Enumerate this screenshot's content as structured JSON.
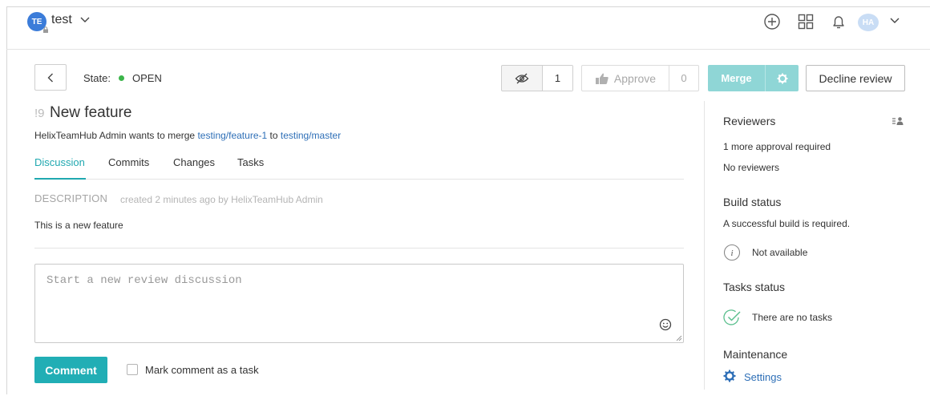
{
  "header": {
    "project_initials": "TE",
    "project_name": "test",
    "user_initials": "HA"
  },
  "review": {
    "state_label": "State:",
    "state_value": "OPEN",
    "watch_count": "1",
    "approve_label": "Approve",
    "approve_count": "0",
    "merge_label": "Merge",
    "decline_label": "Decline review",
    "number": "!9",
    "title": "New feature",
    "merge_prefix": "HelixTeamHub Admin wants to merge",
    "source_branch": "testing/feature-1",
    "merge_to": "to",
    "target_branch": "testing/master"
  },
  "tabs": [
    "Discussion",
    "Commits",
    "Changes",
    "Tasks"
  ],
  "description": {
    "heading": "DESCRIPTION",
    "meta": "created 2 minutes ago by HelixTeamHub Admin",
    "body": "This is a new feature"
  },
  "comment": {
    "placeholder": "Start a new review discussion",
    "button_label": "Comment",
    "task_checkbox_label": "Mark comment as a task"
  },
  "sidebar": {
    "reviewers_heading": "Reviewers",
    "approval_text": "1 more approval required",
    "reviewers_text": "No reviewers",
    "build_heading": "Build status",
    "build_text": "A successful build is required.",
    "build_status": "Not available",
    "tasks_heading": "Tasks status",
    "tasks_text": "There are no tasks",
    "maintenance_heading": "Maintenance",
    "settings_label": "Settings"
  },
  "colors": {
    "accent": "#20a8b0",
    "link": "#2e6fb7",
    "open_state": "#3bb54a",
    "merge_disabled": "#8fd6d6"
  }
}
